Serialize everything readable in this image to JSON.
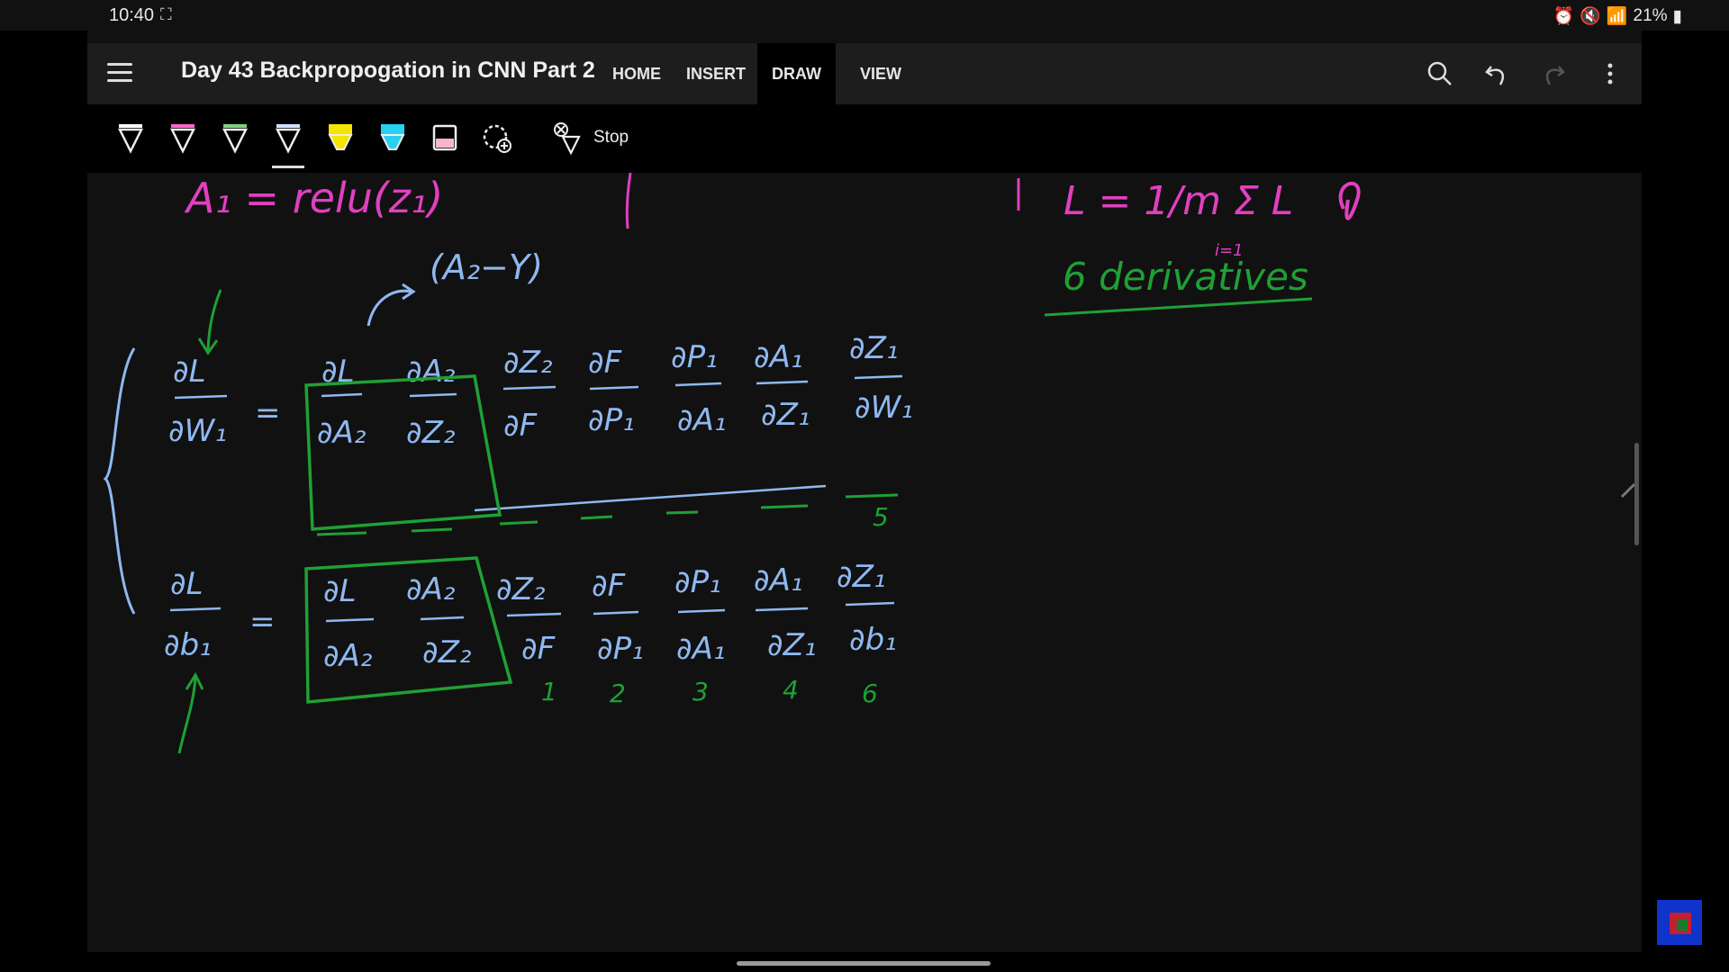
{
  "status_bar": {
    "time": "10:40",
    "battery": "21%"
  },
  "document": {
    "title": "Day 43 Backpropogation in CNN Part 2"
  },
  "tabs": [
    {
      "label": "HOME"
    },
    {
      "label": "INSERT"
    },
    {
      "label": "DRAW"
    },
    {
      "label": "VIEW"
    }
  ],
  "toolbar": {
    "stop_label": "Stop",
    "pen_colors": [
      "#ffffff",
      "#ff66cc",
      "#7fd17f",
      "#cfe0ff",
      "#f5e400",
      "#2ad0f0"
    ]
  },
  "canvas": {
    "ink_colors": {
      "pink": "#e040c0",
      "blue": "#8fb8f0",
      "green": "#1fa035"
    },
    "text_fragments": {
      "top_left_eq": "A₁ = relu(z₁)",
      "top_right_eq": "L = 1/m Σ L",
      "sum_lower": "i=1",
      "a2_minus_y": "(A₂−Y)",
      "six_derivatives": "6 derivatives",
      "row1": {
        "lhs_num": "∂L",
        "lhs_den": "∂W₁",
        "terms": [
          {
            "num": "∂L",
            "den": "∂A₂"
          },
          {
            "num": "∂A₂",
            "den": "∂Z₂"
          },
          {
            "num": "∂Z₂",
            "den": "∂F"
          },
          {
            "num": "∂F",
            "den": "∂P₁"
          },
          {
            "num": "∂P₁",
            "den": "∂A₁"
          },
          {
            "num": "∂A₁",
            "den": "∂Z₁"
          },
          {
            "num": "∂Z₁",
            "den": "∂W₁"
          }
        ],
        "marker": "5"
      },
      "row2": {
        "lhs_num": "∂L",
        "lhs_den": "∂b₁",
        "terms": [
          {
            "num": "∂L",
            "den": "∂A₂"
          },
          {
            "num": "∂A₂",
            "den": "∂Z₂"
          },
          {
            "num": "∂Z₂",
            "den": "∂F"
          },
          {
            "num": "∂F",
            "den": "∂P₁"
          },
          {
            "num": "∂P₁",
            "den": "∂A₁"
          },
          {
            "num": "∂A₁",
            "den": "∂Z₁"
          },
          {
            "num": "∂Z₁",
            "den": "∂b₁"
          }
        ],
        "markers": [
          "1",
          "2",
          "3",
          "4",
          "6"
        ]
      }
    }
  }
}
